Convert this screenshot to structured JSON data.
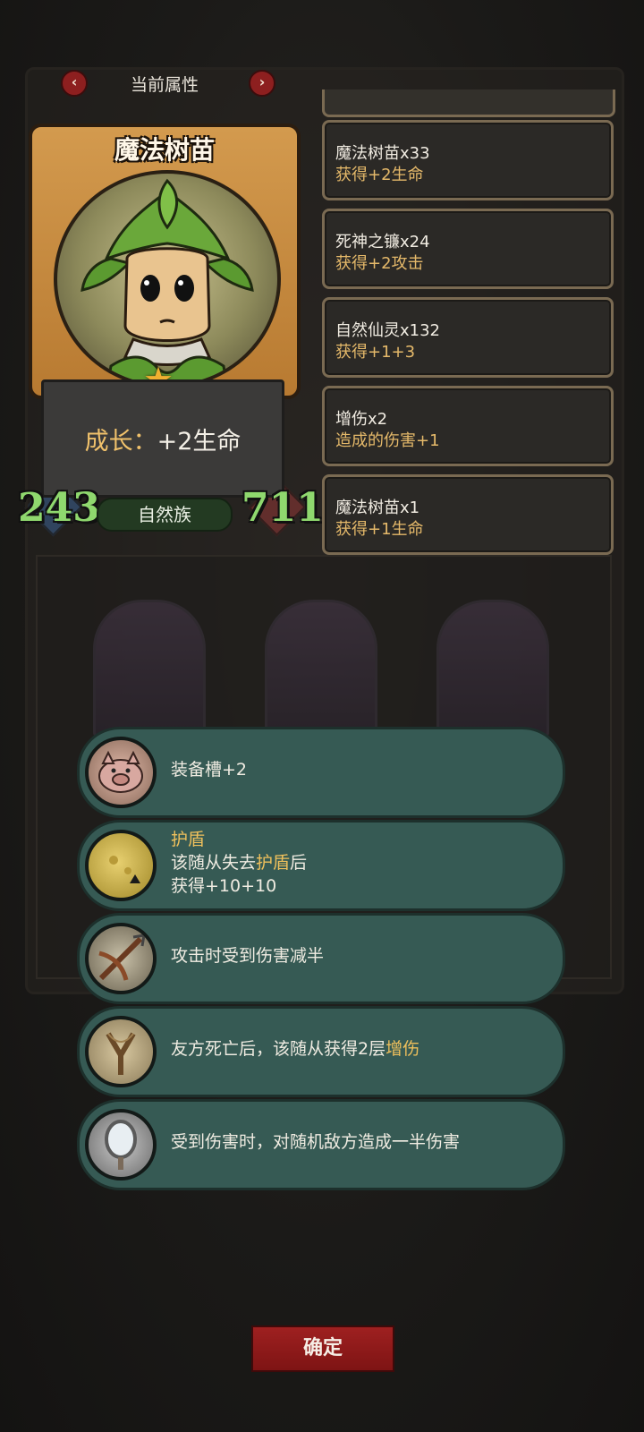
{
  "header": {
    "title": "当前属性",
    "prev_icon": "‹",
    "next_icon": "›"
  },
  "hero": {
    "name": "魔法树苗",
    "growth_label": "成长：",
    "growth_value": "+2生命",
    "tribe": "自然族",
    "attack": "243",
    "health": "711",
    "star_icon": "★"
  },
  "bonuses": [
    {
      "title": "魔法树苗x33",
      "desc": "获得+2生命"
    },
    {
      "title": "死神之镰x24",
      "desc": "获得+2攻击"
    },
    {
      "title": "自然仙灵x132",
      "desc": "获得+1+3"
    },
    {
      "title": "增伤x2",
      "desc": "造成的伤害+1"
    },
    {
      "title": "魔法树苗x1",
      "desc": "获得+1生命"
    }
  ],
  "abilities": [
    {
      "icon": "pig-icon",
      "text": "装备槽+2"
    },
    {
      "icon": "moon-icon",
      "title": "护盾",
      "line1_pre": "该随从失去",
      "line1_hl": "护盾",
      "line1_post": "后",
      "line2": "获得+10+10"
    },
    {
      "icon": "crossbow-icon",
      "text": "攻击时受到伤害减半"
    },
    {
      "icon": "slingshot-icon",
      "text_pre": "友方死亡后，该随从获得2层",
      "text_hl": "增伤"
    },
    {
      "icon": "mirror-icon",
      "text": "受到伤害时，对随机敌方造成一半伤害"
    }
  ],
  "confirm_label": "确定"
}
